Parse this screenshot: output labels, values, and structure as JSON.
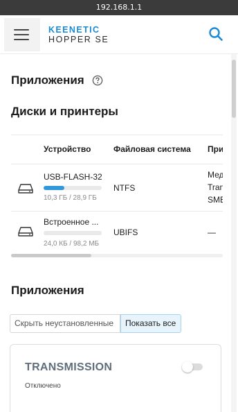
{
  "browser": {
    "url": "192.168.1.1"
  },
  "header": {
    "logo_line1": "KEENETIC",
    "logo_line2": "HOPPER SE",
    "menu_icon": "hamburger-icon",
    "search_icon": "search-icon",
    "accent_color": "#1b8ad4"
  },
  "page": {
    "title": "Приложения",
    "help_icon": "help-icon"
  },
  "disks": {
    "title": "Диски и принтеры",
    "columns": [
      "Устройство",
      "Файловая система",
      "При"
    ],
    "rows": [
      {
        "icon": "drive-icon",
        "name": "USB-FLASH-32",
        "usage": "10,3 ГБ / 28,9 ГБ",
        "usage_fraction": 0.36,
        "filesystem": "NTFS",
        "apps_lines": [
          "Мед",
          "Tran",
          "SMB"
        ]
      },
      {
        "icon": "drive-icon",
        "name": "Встроенное ...",
        "usage": "24,0 КБ / 98,2 МБ",
        "usage_fraction": 0.0,
        "filesystem": "UBIFS",
        "apps_lines": [
          "—"
        ]
      }
    ]
  },
  "apps": {
    "title": "Приложения",
    "filter": {
      "hide_label": "Скрыть неустановленные",
      "show_all_label": "Показать все",
      "selected": "show_all"
    },
    "cards": [
      {
        "name": "TRANSMISSION",
        "status": "Отключено",
        "enabled": false
      }
    ]
  }
}
